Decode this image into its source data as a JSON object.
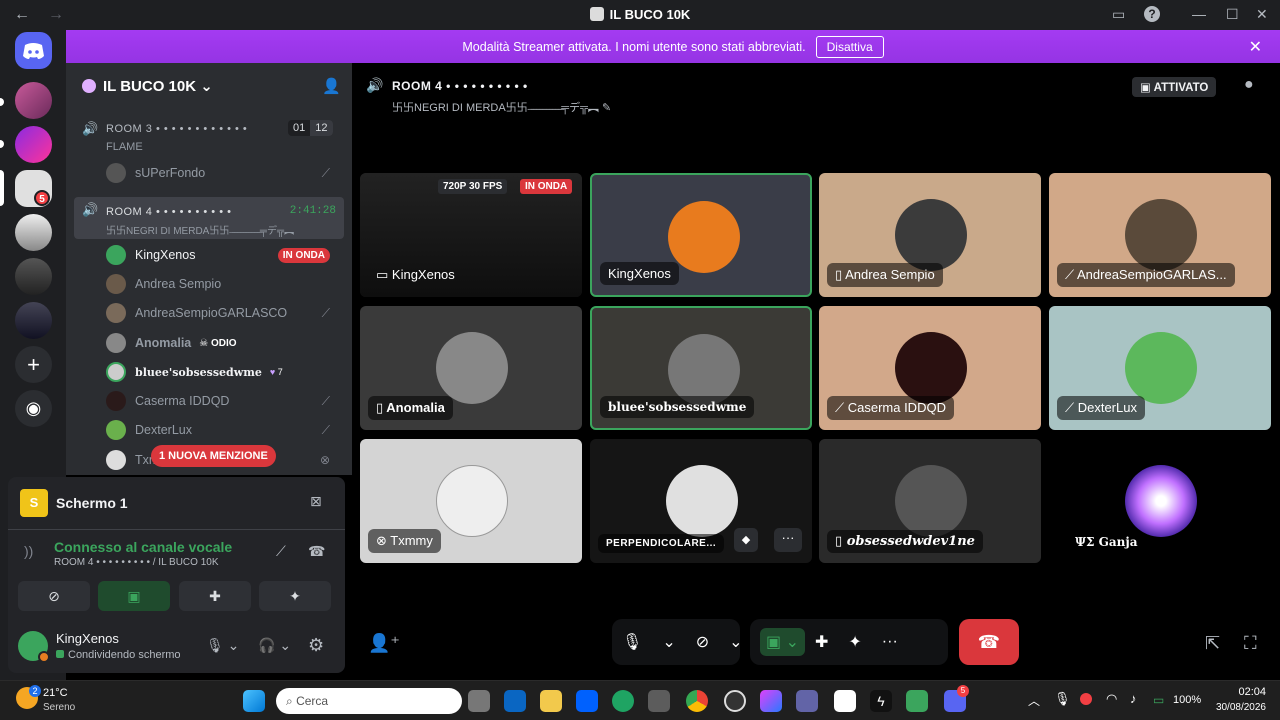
{
  "window": {
    "title": "IL BUCO 10K"
  },
  "banner": {
    "text": "Modalità Streamer attivata. I nomi utente sono stati abbreviati.",
    "button": "Disattiva"
  },
  "server": {
    "name": "IL BUCO 10K"
  },
  "servers": {
    "badge": "5"
  },
  "channels": [
    {
      "name": "ROOM 3 • • • • • • • • • • • •",
      "status": "FLAME",
      "count_a": "01",
      "count_b": "12",
      "users": [
        {
          "name": "sUPerFondo"
        }
      ]
    },
    {
      "name": "ROOM 4 • • • • • • • • • •",
      "status": "卐卐NEGRI DI MERDA卐卐 ̶ ̶ ̶ ̶ ̶ ̶ ̶ ̶ ̶ ̶ ̶╤デ╦︻",
      "timer": "2:41:28",
      "users": [
        {
          "name": "KingXenos",
          "badge": "IN ONDA"
        },
        {
          "name": "Andrea Sempio"
        },
        {
          "name": "AndreaSempioGARLASCO"
        },
        {
          "name": "Anomalia",
          "tag": "ODIO"
        },
        {
          "name": "bluee'sobsessedwme",
          "tag": "7"
        },
        {
          "name": "Caserma IDDQD"
        },
        {
          "name": "DexterLux"
        },
        {
          "name": "Txm"
        }
      ]
    }
  ],
  "mention_pill": "1 NUOVA MENZIONE",
  "panel": {
    "screen_title": "Schermo 1",
    "voice_status": "Connesso al canale vocale",
    "voice_location": "ROOM 4 • • • • • • • • • / IL BUCO 10K",
    "user_name": "KingXenos",
    "user_status": "Condividendo schermo"
  },
  "main_header": {
    "channel": "ROOM 4 • • • • • • • • • •",
    "status": "卐卐NEGRI DI MERDA卐卐 ̶ ̶ ̶ ̶ ̶ ̶ ̶ ̶ ̶ ̶ ̶╤デ╦︻",
    "activated": "ATTIVATO"
  },
  "stream_badge": {
    "quality": "720P 30 FPS",
    "live": "IN ONDA"
  },
  "tiles": [
    {
      "name": "KingXenos",
      "color": "#2a2a2a"
    },
    {
      "name": "KingXenos",
      "color": "#3a3d48"
    },
    {
      "name": "Andrea Sempio",
      "color": "#c9a98a"
    },
    {
      "name": "AndreaSempioGARLAS...",
      "color": "#d1a888"
    },
    {
      "name": "Anomalia",
      "color": "#3a3a3a"
    },
    {
      "name": "bluee'sobsessedwme",
      "color": "#3b3a36"
    },
    {
      "name": "Caserma IDDQD",
      "color": "#d2a88a"
    },
    {
      "name": "DexterLux",
      "color": "#a9c4c4"
    },
    {
      "name": "Txmmy",
      "color": "#d4d4d4"
    },
    {
      "name": "PERPENDICOLARE...",
      "color": "#151515"
    },
    {
      "name": "obsessedwdev1ne",
      "color": "#2a2a2a"
    },
    {
      "name": "ΨΣ Ganja",
      "color": "#000000"
    }
  ],
  "taskbar": {
    "weather_temp": "21°C",
    "weather_desc": "Sereno",
    "weather_badge": "2",
    "search": "Cerca",
    "battery": "100%",
    "time": "02:04",
    "date": "30/08/2026",
    "discord_badge": "5"
  }
}
